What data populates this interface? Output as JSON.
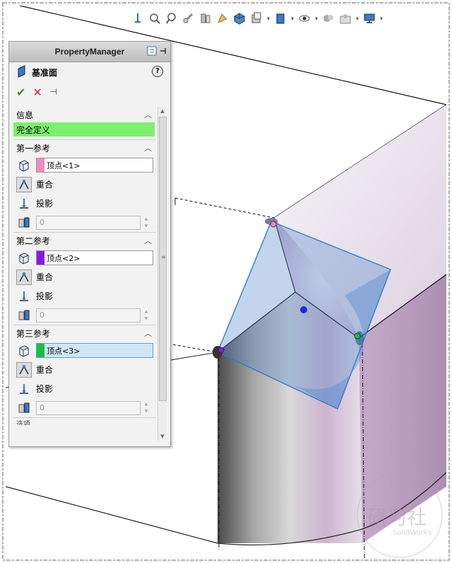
{
  "toolbar": {
    "icons": [
      "view-orientation-icon",
      "zoom-to-fit-icon",
      "zoom-area-icon",
      "previous-view-icon",
      "section-view-icon",
      "dynamic-annotation-icon",
      "view-orientation-cube-icon",
      "display-style-icon",
      "hide-show-icon",
      "edit-appearance-icon",
      "apply-scene-icon",
      "view-settings-icon"
    ]
  },
  "property_manager": {
    "header_title": "PropertyManager",
    "feature_title": "基准面",
    "help": "?",
    "info": {
      "title": "信息",
      "status": "完全定义",
      "status_color": "#7df06e"
    },
    "references": [
      {
        "title": "第一参考",
        "selection": "顶点<1>",
        "color": "#f08bbd",
        "coincident_label": "重合",
        "projection_label": "投影",
        "distance_value": "0",
        "active": false
      },
      {
        "title": "第二参考",
        "selection": "顶点<2>",
        "color": "#8a19e8",
        "coincident_label": "重合",
        "projection_label": "投影",
        "distance_value": "0",
        "active": false
      },
      {
        "title": "第三参考",
        "selection": "顶点<3>",
        "color": "#18c040",
        "coincident_label": "重合",
        "projection_label": "投影",
        "distance_value": "0",
        "active": true
      }
    ],
    "cut_off_label": "选项"
  },
  "watermark": {
    "text": "研习社",
    "subtext": "SolidWorks"
  },
  "colors": {
    "plane_fill": "#5a8ed0",
    "plane_edge": "#2f7ad0",
    "model_face_light": "#f4f0f7",
    "model_face_shade": "#c2a8c6"
  }
}
